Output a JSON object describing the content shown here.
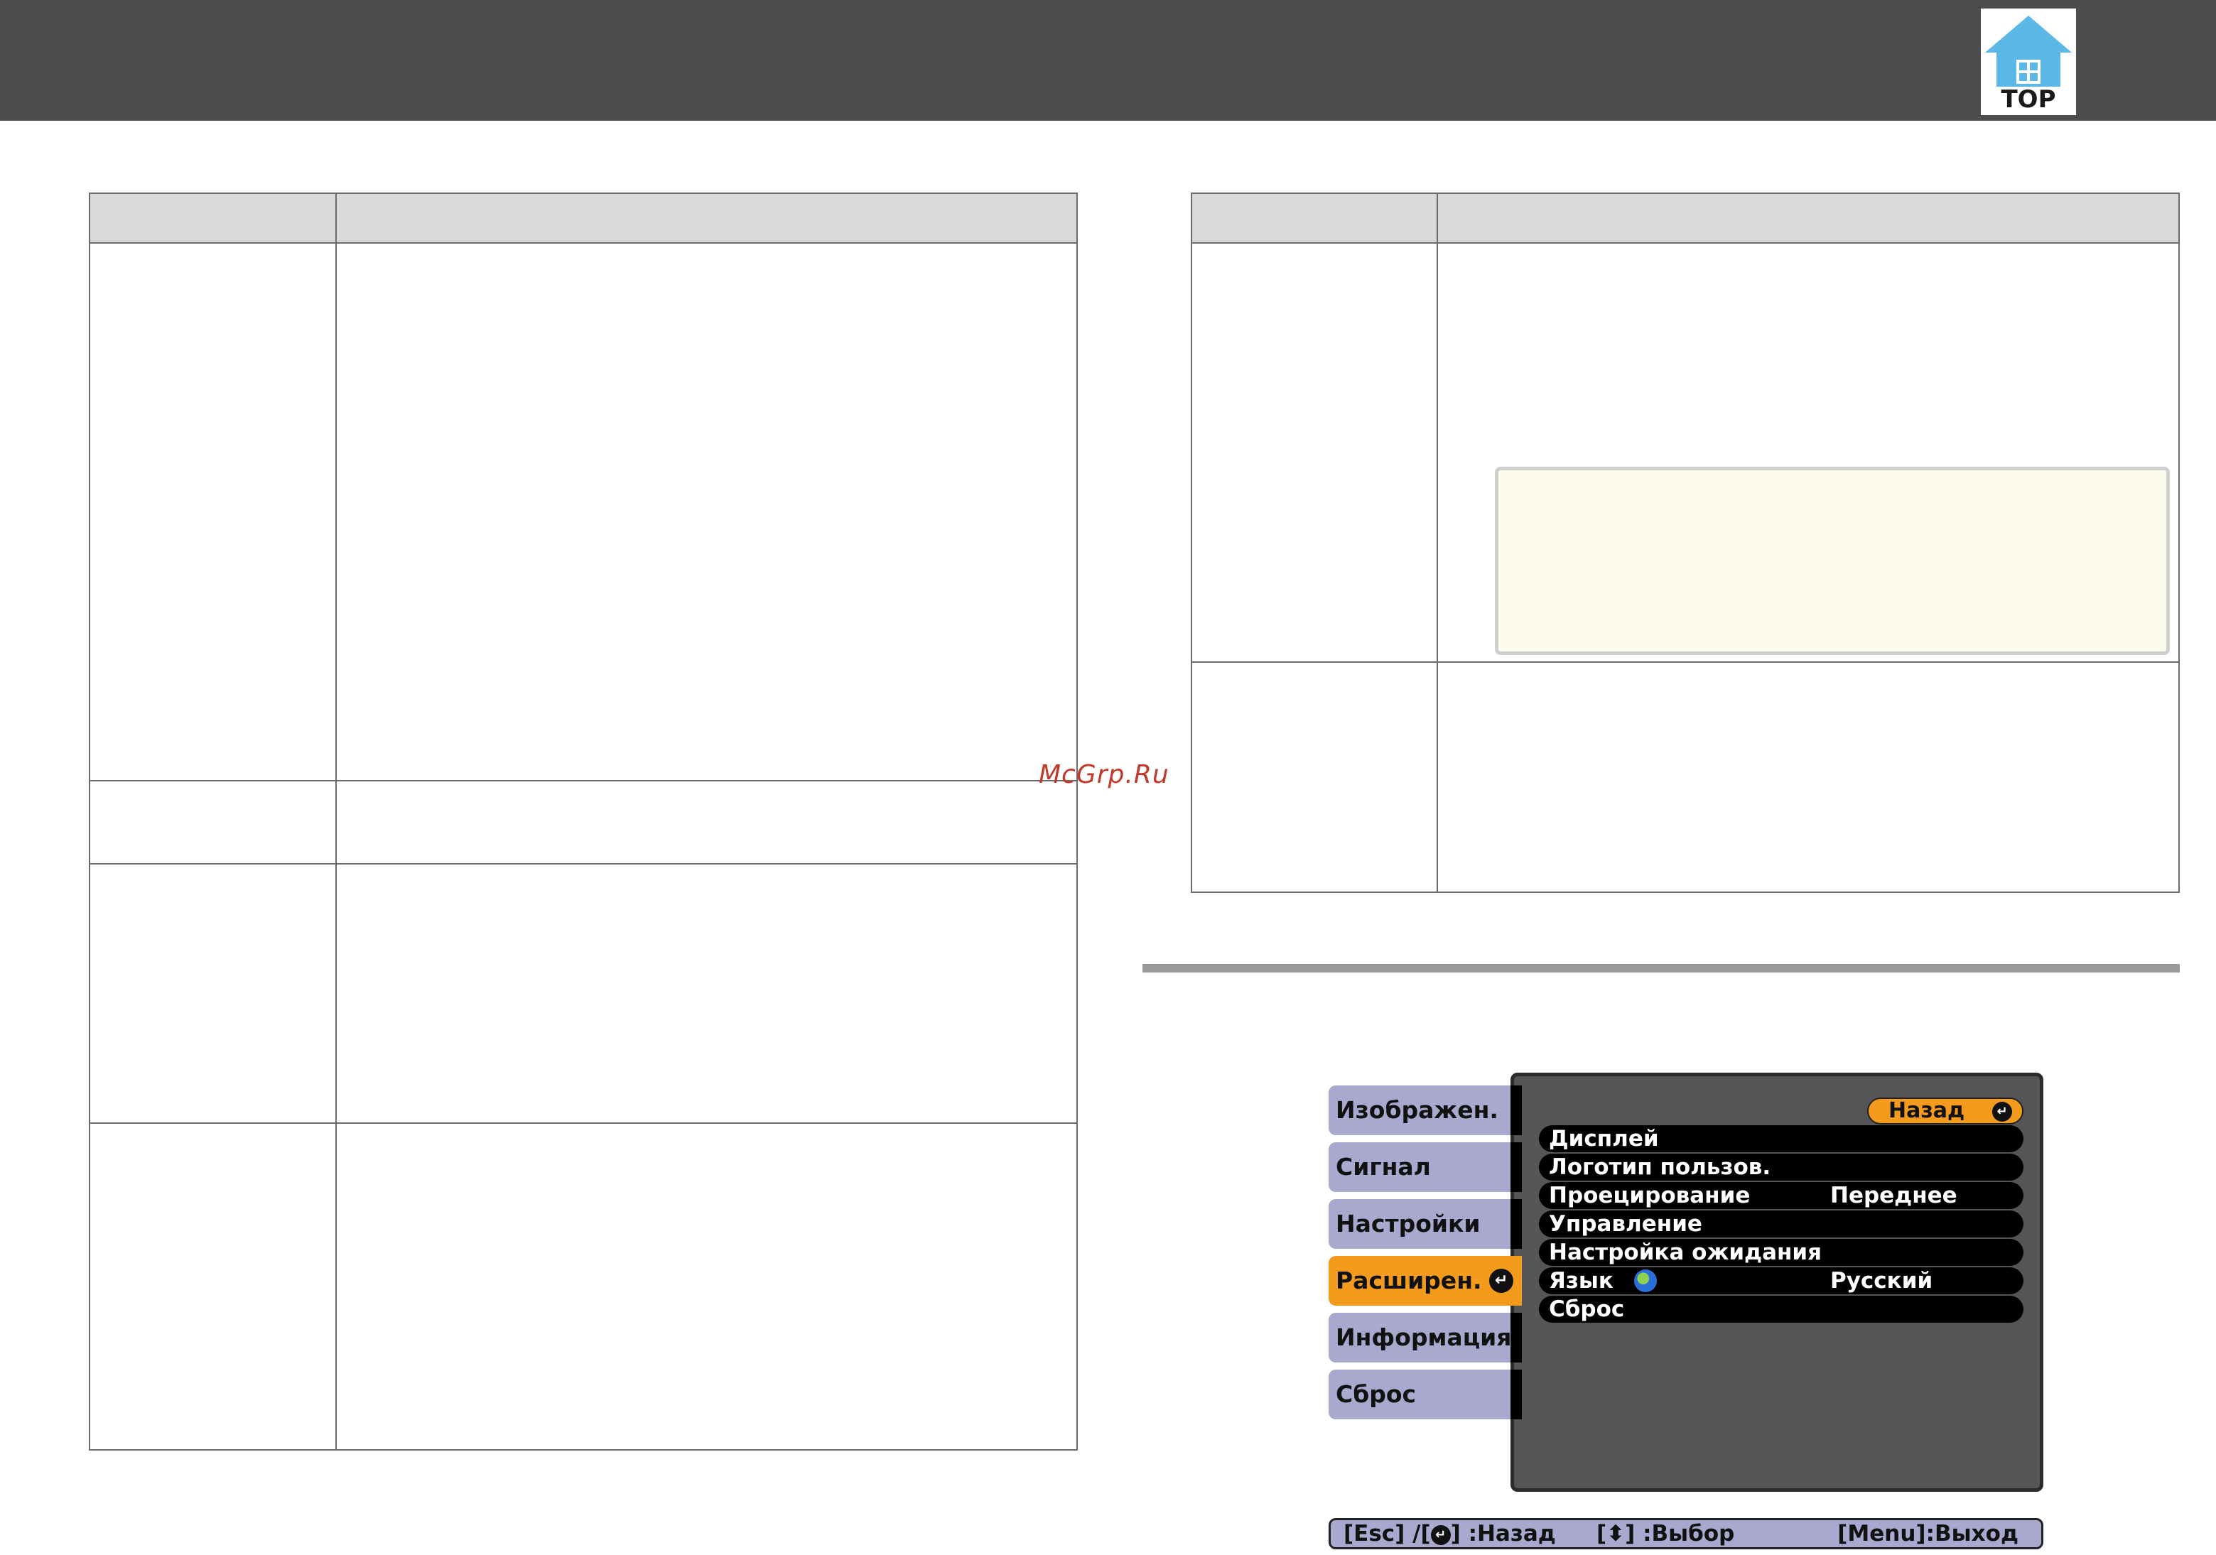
{
  "header": {
    "logo_text": "TOP"
  },
  "watermark": "McGrp.Ru",
  "projector_menu": {
    "tabs": [
      {
        "label": "Изображен.",
        "active": false
      },
      {
        "label": "Сигнал",
        "active": false
      },
      {
        "label": "Настройки",
        "active": false
      },
      {
        "label": "Расширен.",
        "active": true
      },
      {
        "label": "Информация",
        "active": false
      },
      {
        "label": "Сброс",
        "active": false
      }
    ],
    "back_label": "Назад",
    "items": [
      {
        "label": "Дисплей",
        "value": ""
      },
      {
        "label": "Логотип пользов.",
        "value": ""
      },
      {
        "label": "Проецирование",
        "value": "Переднее"
      },
      {
        "label": "Управление",
        "value": ""
      },
      {
        "label": "Настройка ожидания",
        "value": ""
      },
      {
        "label": "Язык",
        "value": "Русский"
      },
      {
        "label": "Сброс",
        "value": ""
      }
    ],
    "help": {
      "esc_prefix": "[Esc] /[",
      "esc_suffix": "] :Назад",
      "select_prefix": "[",
      "select_suffix": "] :Выбор",
      "menu_exit": "[Menu]:Выход"
    },
    "colors": {
      "active": "#f49b1e",
      "tab": "#a9a9cf",
      "panel": "#555555"
    }
  }
}
